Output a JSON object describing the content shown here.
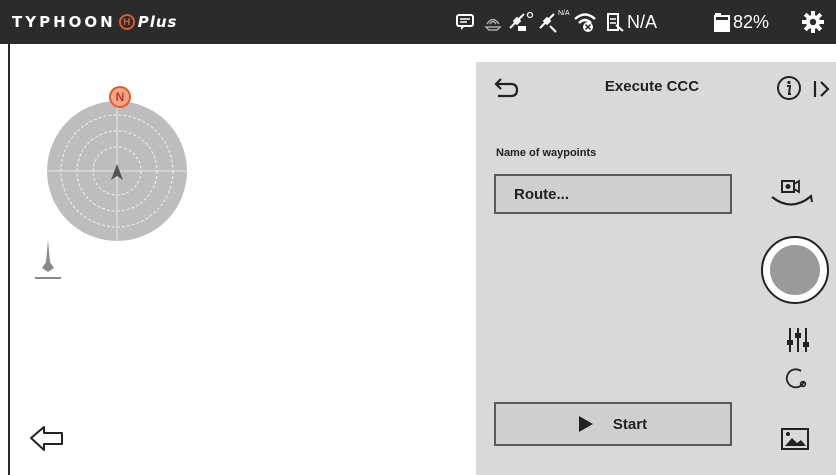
{
  "topbar": {
    "logo_word": "TYPHOON",
    "logo_badge": "H",
    "logo_plus": "Plus",
    "status_na_small": "N/A",
    "status_na": "N/A",
    "battery": "82%",
    "icons": [
      "message-icon",
      "signal-icon",
      "gps-satellite-icon",
      "remote-satellite-icon",
      "wifi-off-icon",
      "remote-battery-icon",
      "drone-battery-icon",
      "settings-gear-icon"
    ]
  },
  "map": {
    "compass_north": "N"
  },
  "panel": {
    "title": "Execute CCC",
    "waypoints_label": "Name of waypoints",
    "route_value": "Route...",
    "start_label": "Start"
  },
  "colors": {
    "topbar_bg": "#2b2b2b",
    "panel_bg": "#d9d9d9",
    "compass_accent": "#e05a2b",
    "radar_fill": "#bdbdbd"
  }
}
